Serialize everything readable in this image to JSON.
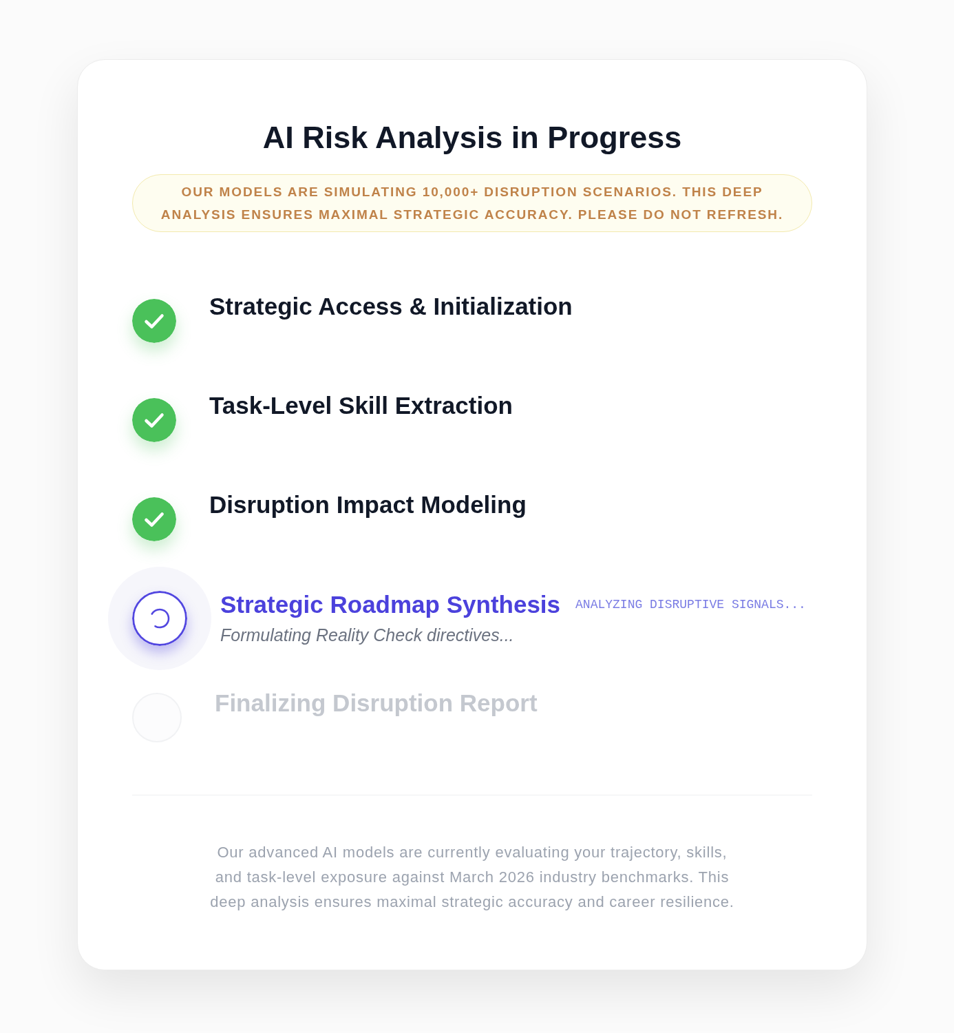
{
  "title": "AI Risk Analysis in Progress",
  "notice": "OUR MODELS ARE SIMULATING 10,000+ DISRUPTION SCENARIOS. THIS DEEP ANALYSIS ENSURES MAXIMAL STRATEGIC ACCURACY. PLEASE DO NOT REFRESH.",
  "steps": [
    {
      "label": "Strategic Access & Initialization",
      "kind": "done"
    },
    {
      "label": "Task-Level Skill Extraction",
      "kind": "done"
    },
    {
      "label": "Disruption Impact Modeling",
      "kind": "done"
    },
    {
      "label": "Strategic Roadmap Synthesis",
      "kind": "active",
      "tag": "ANALYZING DISRUPTIVE SIGNALS...",
      "detail": "Formulating Reality Check directives..."
    },
    {
      "label": "Finalizing Disruption Report",
      "kind": "pending"
    }
  ],
  "footer": "Our advanced AI models are currently evaluating your trajectory, skills, and task-level exposure against March 2026 industry benchmarks. This deep analysis ensures maximal strategic accuracy and career resilience."
}
